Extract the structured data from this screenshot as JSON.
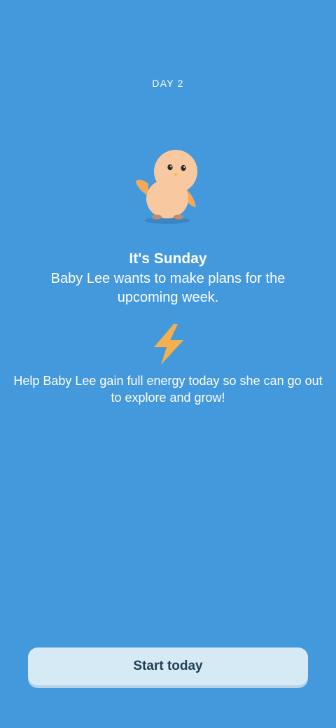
{
  "screen": {
    "day_label": "DAY 2",
    "headline": "It's Sunday",
    "subline": "Baby Lee wants to make plans for the upcoming week.",
    "body": "Help Baby Lee gain full energy today so she can go out to explore and grow!",
    "mascot_icon": "baby-bird-mascot-icon",
    "energy_icon": "lightning-bolt-icon"
  },
  "actions": {
    "start_label": "Start today"
  },
  "colors": {
    "background": "#4499DD",
    "button_bg": "#D6EAF6",
    "button_text": "#234055",
    "bolt": "#F4B04E",
    "mascot_body": "#F8C9A0"
  }
}
